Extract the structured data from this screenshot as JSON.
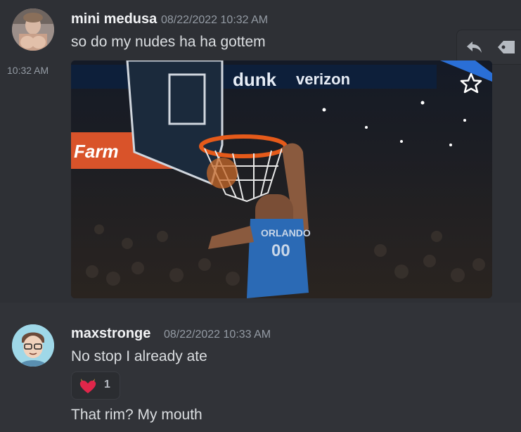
{
  "messages": [
    {
      "username": "mini medusa",
      "timestamp": "08/22/2022 10:32 AM",
      "text": "so do my nudes ha ha gottem",
      "gif_time": "10:32 AM",
      "gif_banner": "verizon",
      "gif_banner_word": "dunk",
      "gif_sign": "Farm",
      "gif_jersey_team": "ORLANDO",
      "gif_jersey_number": "00"
    },
    {
      "username": "maxstronge",
      "timestamp": "08/22/2022 10:33 AM",
      "text": "No stop I already ate",
      "reaction_count": "1",
      "reaction_emoji": "heart-with-horns",
      "text2": "That rim? My mouth"
    }
  ],
  "toolbar": {
    "icons": [
      "reply-icon",
      "forward-icon"
    ]
  },
  "colors": {
    "background": "#313338",
    "hover": "#2e3035",
    "timestamp": "#949ba4",
    "text": "#dbdee1"
  }
}
